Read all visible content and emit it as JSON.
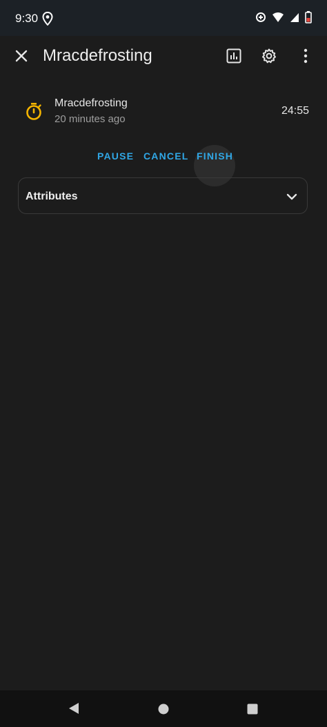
{
  "status_bar": {
    "time": "9:30",
    "icons": [
      "location-icon",
      "data-saver-icon",
      "wifi-icon",
      "signal-icon",
      "battery-icon"
    ]
  },
  "app_bar": {
    "title": "Mracdefrosting",
    "icons": [
      "close-icon",
      "history-icon",
      "gear-icon",
      "more-vert-icon"
    ]
  },
  "entity": {
    "name": "Mracdefrosting",
    "last_changed": "20 minutes ago",
    "state": "24:55",
    "icon": "timer-icon",
    "icon_color": "#f4b400"
  },
  "actions": {
    "pause": "PAUSE",
    "cancel": "CANCEL",
    "finish": "FINISH",
    "color": "#30a7e6"
  },
  "attributes": {
    "label": "Attributes"
  },
  "nav_bar": {
    "icons": [
      "back-icon",
      "home-icon",
      "recents-icon"
    ]
  }
}
